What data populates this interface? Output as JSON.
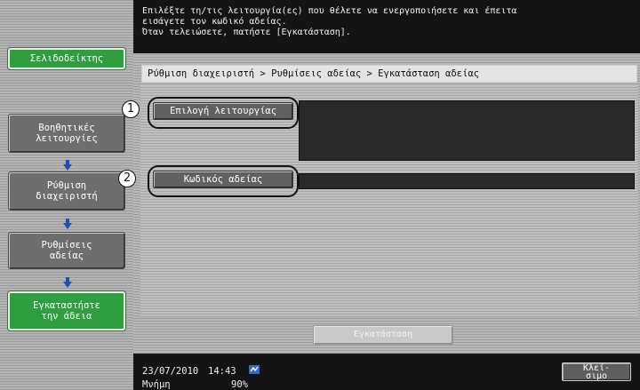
{
  "header": {
    "message_line1": "Επιλέξτε τη/τις λειτουργία(ες) που θέλετε να ενεργοποιήσετε και έπειτα",
    "message_line2": "εισάγετε τον κωδικό αδείας.",
    "message_line3": "Όταν τελειώσετε, πατήστε [Εγκατάσταση]."
  },
  "sidebar": {
    "bookmark_label": "Σελιδοδείκτης",
    "steps": [
      {
        "line1": "Βοηθητικές",
        "line2": "λειτουργίες"
      },
      {
        "line1": "Ρύθμιση",
        "line2": "διαχειριστή"
      },
      {
        "line1": "Ρυθμίσεις",
        "line2": "αδείας"
      },
      {
        "line1": "Εγκαταστήστε",
        "line2": "την άδεια"
      }
    ]
  },
  "main": {
    "breadcrumb": "Ρύθμιση διαχειριστή > Ρυθμίσεις αδείας > Εγκατάσταση αδείας",
    "function_select_label": "Επιλογή λειτουργίας",
    "license_code_label": "Κωδικός αδείας",
    "callout_1": "1",
    "callout_2": "2",
    "install_label": "Εγκατάσταση"
  },
  "status": {
    "date": "23/07/2010",
    "time": "14:43",
    "memory_label": "Μνήμη",
    "memory_value": "90%",
    "close_line1": "Κλεί-",
    "close_line2": "σιμο"
  },
  "colors": {
    "accent_green": "#2f9e3f",
    "arrow_blue": "#1f4fb5",
    "bar_black": "#141414"
  }
}
